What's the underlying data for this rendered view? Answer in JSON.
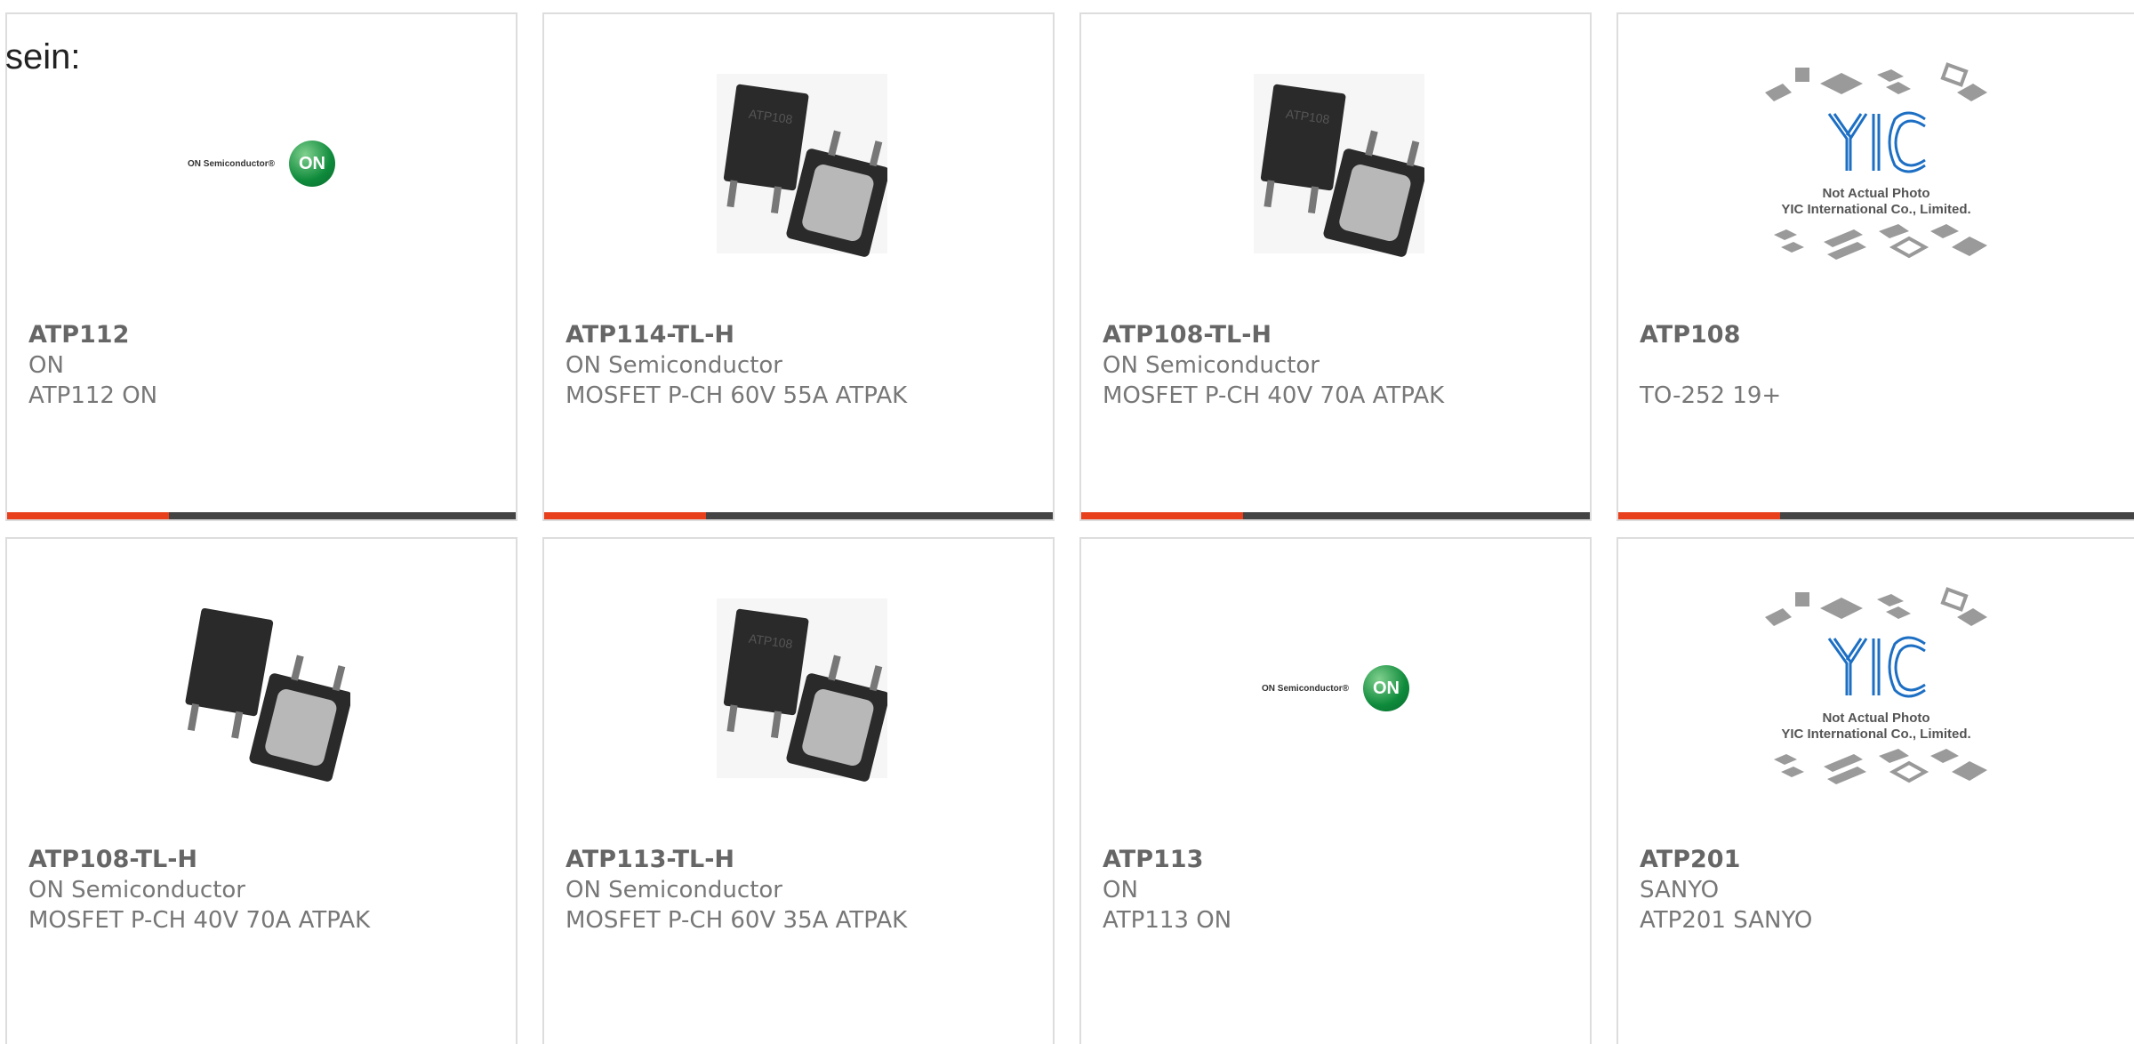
{
  "intro_text": "sein:",
  "colors": {
    "accent": "#e8401c",
    "bar": "#444444",
    "border": "#dddddd"
  },
  "cards": [
    {
      "part": "ATP112",
      "manufacturer": "ON",
      "description": "ATP112 ON",
      "image": "on-semiconductor-logo",
      "logo_text": "ON Semiconductor®",
      "logo_mark": "ON"
    },
    {
      "part": "ATP114-TL-H",
      "manufacturer": "ON Semiconductor",
      "description": "MOSFET P-CH 60V 55A ATPAK",
      "image": "atpak-package-photo",
      "chip_mark": "ATP108"
    },
    {
      "part": "ATP108-TL-H",
      "manufacturer": "ON Semiconductor",
      "description": "MOSFET P-CH 40V 70A ATPAK",
      "image": "atpak-package-photo",
      "chip_mark": "ATP108"
    },
    {
      "part": "ATP108",
      "manufacturer": "",
      "description": "TO-252 19+",
      "image": "yic-placeholder",
      "placeholder_line1": "Not Actual Photo",
      "placeholder_line2": "YIC International Co., Limited."
    },
    {
      "part": "ATP108-TL-H",
      "manufacturer": "ON Semiconductor",
      "description": "MOSFET P-CH 40V 70A ATPAK",
      "image": "atpak-package-photo",
      "chip_mark": ""
    },
    {
      "part": "ATP113-TL-H",
      "manufacturer": "ON Semiconductor",
      "description": "MOSFET P-CH 60V 35A ATPAK",
      "image": "atpak-package-photo",
      "chip_mark": "ATP108"
    },
    {
      "part": "ATP113",
      "manufacturer": "ON",
      "description": "ATP113 ON",
      "image": "on-semiconductor-logo",
      "logo_text": "ON Semiconductor®",
      "logo_mark": "ON"
    },
    {
      "part": "ATP201",
      "manufacturer": "SANYO",
      "description": "ATP201 SANYO",
      "image": "yic-placeholder",
      "placeholder_line1": "Not Actual Photo",
      "placeholder_line2": "YIC International Co., Limited."
    }
  ]
}
